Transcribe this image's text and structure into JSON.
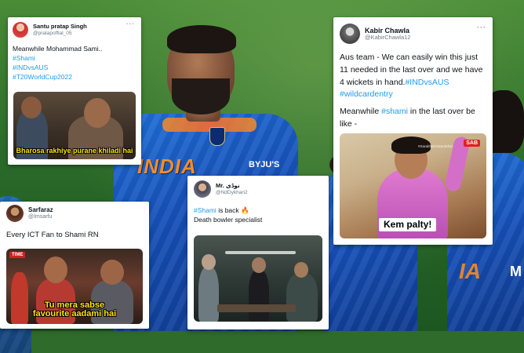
{
  "colors": {
    "hashtag": "#1d9bf0",
    "jersey_blue": "#1650b8",
    "jersey_orange": "#f28c28",
    "pitch_green": "#2d6a2b",
    "caption_yellow": "#ffe600"
  },
  "background": {
    "jersey_text": "INDIA",
    "sponsor": "BYJU'S",
    "right_jersey_letter": "M"
  },
  "tweet1": {
    "display_name": "Santu pratap Singh",
    "handle": "@pratapoffial_05",
    "text_line1": "Meanwhile Mohammad Sami..",
    "hashtags": [
      "#Shami",
      "#INDvsAUS",
      "#T20WorldCup2022"
    ],
    "media_caption": "Bharosa rakhiye purane khiladi hai",
    "more_icon": "more-dots-icon"
  },
  "tweet2": {
    "display_name": "Kabir Chawla",
    "handle": "@KabirChawla12",
    "text_part1": "Aus team - We can easily win this just 11 needed in the last over and we have 4 wickets in hand.",
    "hashtag1": "#INDvsAUS",
    "hashtag2": "#wildcardentry",
    "text_part2": "Meanwhile ",
    "hashtag3": "#shami",
    "text_part3": " in the last over be like -",
    "media_caption": "Kem palty!",
    "media_watermark": "SAB",
    "media_credit": "#SarabhaiVsSarabhai"
  },
  "tweet3": {
    "display_name": "Sarfaraz",
    "handle": "@Imsarfu",
    "text": "Every ICT Fan to Shami RN",
    "media_caption_line1": "Tu mera sabse",
    "media_caption_line2": "favourite aadami hai",
    "media_logo": "TIME"
  },
  "tweet4": {
    "display_name": "Mr. نوڈی",
    "handle": "@NdDykhan2",
    "hashtag": "#Shami",
    "text_after_hashtag": " is back ",
    "emoji": "🔥",
    "text_line2": "Death bowler specialist"
  }
}
